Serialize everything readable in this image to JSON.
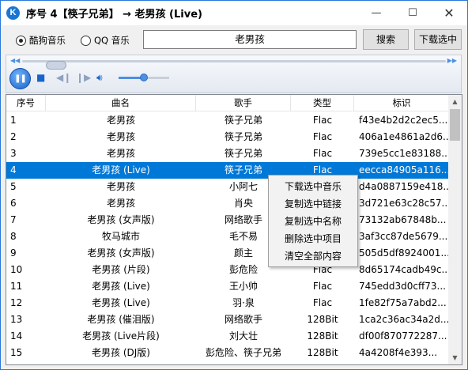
{
  "window": {
    "title": "序号 4【筷子兄弟】 → 老男孩 (Live)",
    "app_icon_letter": "K",
    "minimize": "—",
    "maximize": "☐",
    "close": "✕"
  },
  "search": {
    "source_kugou": "酷狗音乐",
    "source_qq": "QQ 音乐",
    "selected_source": "酷狗音乐",
    "query": "老男孩",
    "search_button": "搜索",
    "download_button": "下载选中"
  },
  "player": {
    "state": "paused",
    "volume_level": 0.5,
    "seek_position": 0.0
  },
  "table": {
    "columns": [
      "序号",
      "曲名",
      "歌手",
      "类型",
      "标识"
    ],
    "selected_index": 3,
    "rows": [
      {
        "idx": "1",
        "name": "老男孩",
        "artist": "筷子兄弟",
        "type": "Flac",
        "id": "f43e4b2d2c2ec5..."
      },
      {
        "idx": "2",
        "name": "老男孩",
        "artist": "筷子兄弟",
        "type": "Flac",
        "id": "406a1e4861a2d6..."
      },
      {
        "idx": "3",
        "name": "老男孩",
        "artist": "筷子兄弟",
        "type": "Flac",
        "id": "739e5cc1e83188..."
      },
      {
        "idx": "4",
        "name": "老男孩 (Live)",
        "artist": "筷子兄弟",
        "type": "Flac",
        "id": "eecca84905a116..."
      },
      {
        "idx": "5",
        "name": "老男孩",
        "artist": "小阿七",
        "type": "Flac",
        "id": "d4a0887159e418..."
      },
      {
        "idx": "6",
        "name": "老男孩",
        "artist": "肖央",
        "type": "Flac",
        "id": "3d721e63c28c57..."
      },
      {
        "idx": "7",
        "name": "老男孩 (女声版)",
        "artist": "网络歌手",
        "type": "Flac",
        "id": "73132ab67848b..."
      },
      {
        "idx": "8",
        "name": "牧马城市",
        "artist": "毛不易",
        "type": "Flac",
        "id": "3af3cc87de5679..."
      },
      {
        "idx": "9",
        "name": "老男孩 (女声版)",
        "artist": "颜主",
        "type": "Flac",
        "id": "505d5df8924001..."
      },
      {
        "idx": "10",
        "name": "老男孩 (片段)",
        "artist": "彭危险",
        "type": "Flac",
        "id": "8d65174cadb49c..."
      },
      {
        "idx": "11",
        "name": "老男孩 (Live)",
        "artist": "王小帅",
        "type": "Flac",
        "id": "745edd3d0cff73..."
      },
      {
        "idx": "12",
        "name": "老男孩 (Live)",
        "artist": "羽·泉",
        "type": "Flac",
        "id": "1fe82f75a7abd2..."
      },
      {
        "idx": "13",
        "name": "老男孩 (催泪版)",
        "artist": "网络歌手",
        "type": "128Bit",
        "id": "1ca2c36ac34a2d..."
      },
      {
        "idx": "14",
        "name": "老男孩 (Live片段)",
        "artist": "刘大壮",
        "type": "128Bit",
        "id": "df00f870772287..."
      },
      {
        "idx": "15",
        "name": "老男孩 (DJ版)",
        "artist": "彭危险、筷子兄弟",
        "type": "128Bit",
        "id": "4a4208f4e393..."
      }
    ]
  },
  "context_menu": {
    "items": [
      "下载选中音乐",
      "复制选中链接",
      "复制选中名称",
      "删除选中项目",
      "清空全部内容"
    ]
  },
  "colors": {
    "selection": "#0078d7",
    "accent": "#1a63c8"
  },
  "icons": {
    "play": "pause-icon",
    "stop": "stop-icon",
    "prev": "previous-icon",
    "next": "next-icon",
    "volume": "volume-icon"
  }
}
